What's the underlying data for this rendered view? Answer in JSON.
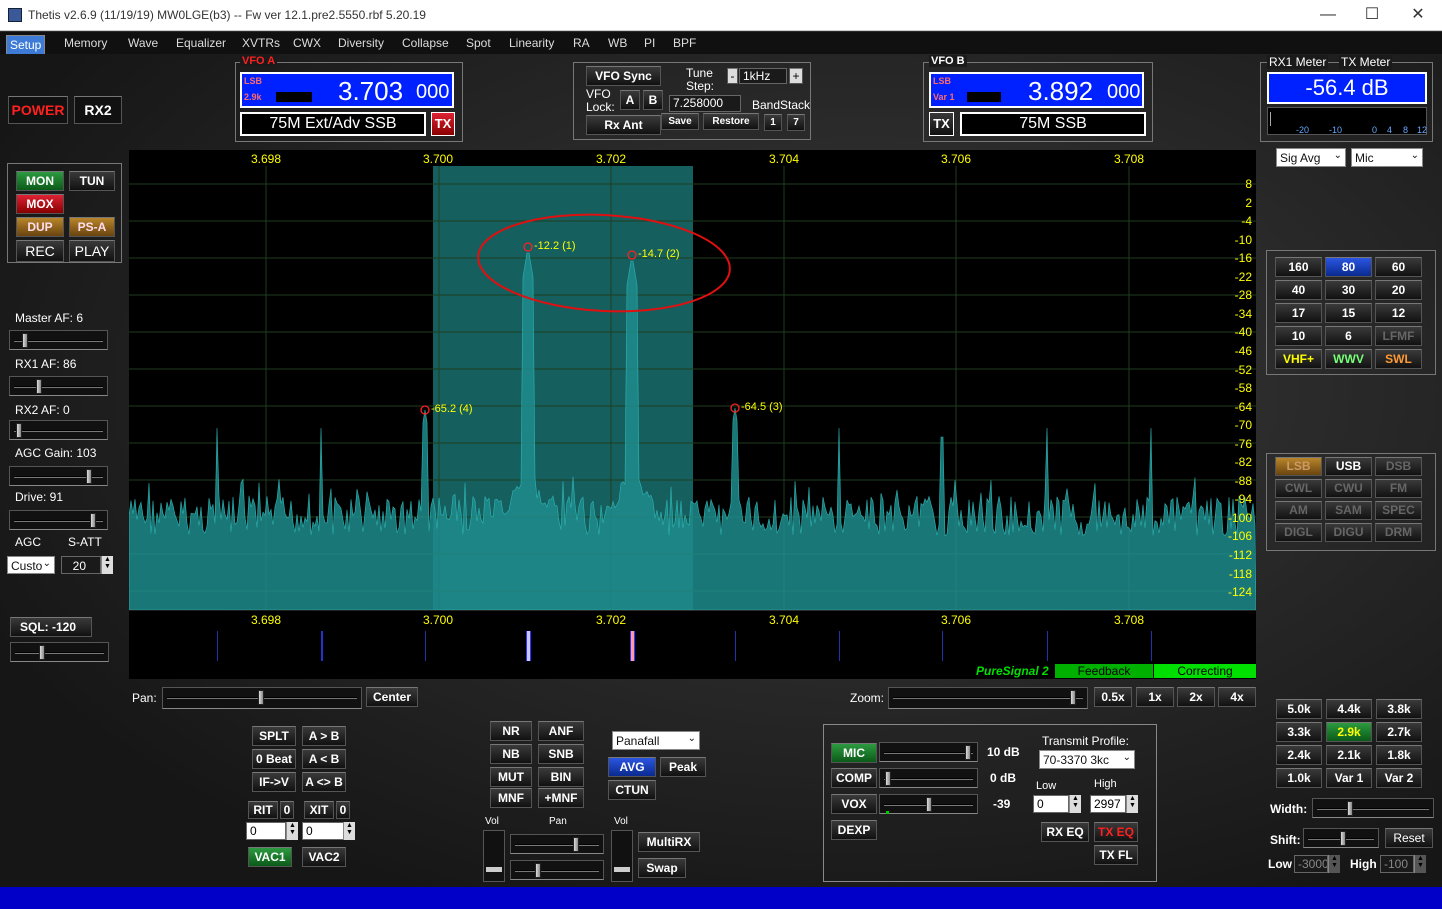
{
  "window": {
    "title": "Thetis v2.6.9 (11/19/19) MW0LGE(b3)   --   Fw ver 12.1.pre2.5550.rbf 5.20.19",
    "minimize": "—",
    "maximize": "☐",
    "close": "✕"
  },
  "menu": [
    "Setup",
    "Memory",
    "Wave",
    "Equalizer",
    "XVTRs",
    "CWX",
    "Diversity",
    "Collapse",
    "Spot",
    "Linearity",
    "RA",
    "WB",
    "PI",
    "BPF"
  ],
  "power": {
    "power": "POWER",
    "rx2": "RX2"
  },
  "mode_buttons": {
    "mon": "MON",
    "tun": "TUN",
    "mox": "MOX",
    "dup": "DUP",
    "psa": "PS-A",
    "rec": "REC",
    "play": "PLAY"
  },
  "left_controls": {
    "master_af": "Master AF:  6",
    "rx1_af": "RX1 AF:  86",
    "rx2_af": "RX2 AF:  0",
    "agc_gain": "AGC Gain:  103",
    "drive": "Drive:  91",
    "agc": "AGC",
    "satt": "S-ATT",
    "agc_mode": "Custo",
    "satt_value": "20",
    "sql": "SQL: -120"
  },
  "vfo_a": {
    "title": "VFO A",
    "mode": "LSB",
    "filter": "2.9k",
    "freq_main": "3.703",
    "freq_sub": "000",
    "band": "75M Ext/Adv SSB",
    "tx": "TX"
  },
  "vfo_sync": {
    "sync": "VFO Sync",
    "tune": "Tune",
    "step": "Step:",
    "minus": "-",
    "step_value": "1kHz",
    "plus": "+",
    "vfo": "VFO",
    "lock": "Lock:",
    "a": "A",
    "b": "B",
    "freq": "7.258000",
    "bandstack": "BandStack",
    "rxant": "Rx Ant",
    "save": "Save",
    "restore": "Restore",
    "bs1": "1",
    "bs2": "7"
  },
  "vfo_b": {
    "title": "VFO B",
    "mode": "LSB",
    "filter": "Var 1",
    "freq_main": "3.892",
    "freq_sub": "000",
    "band": "75M SSB",
    "tx": "TX"
  },
  "meters": {
    "rx1_label": "RX1 Meter",
    "tx_label": "TX Meter",
    "value": "-56.4 dB",
    "scale": [
      "-20",
      "-10",
      "0",
      "4",
      "8",
      "12"
    ],
    "rx_mode": "Sig Avg",
    "tx_mode": "Mic"
  },
  "spectrum": {
    "freq_ticks": [
      "3.698",
      "3.700",
      "3.702",
      "3.704",
      "3.706",
      "3.708"
    ],
    "db_ticks": [
      "8",
      "2",
      "-4",
      "-10",
      "-16",
      "-22",
      "-28",
      "-34",
      "-40",
      "-46",
      "-52",
      "-58",
      "-64",
      "-70",
      "-76",
      "-82",
      "-88",
      "-94",
      "-100",
      "-106",
      "-112",
      "-118",
      "-124"
    ],
    "markers": [
      "-12.2 (1)",
      "-14.7 (2)",
      "-65.2 (4)",
      "-64.5 (3)"
    ],
    "puresignal": "PureSignal 2",
    "feedback": "Feedback",
    "correcting": "Correcting"
  },
  "bands": [
    "160",
    "80",
    "60",
    "40",
    "30",
    "20",
    "17",
    "15",
    "12",
    "10",
    "6",
    "LFMF",
    "VHF+",
    "WWV",
    "SWL"
  ],
  "modes": [
    "LSB",
    "USB",
    "DSB",
    "CWL",
    "CWU",
    "FM",
    "AM",
    "SAM",
    "SPEC",
    "DIGL",
    "DIGU",
    "DRM"
  ],
  "pan_zoom": {
    "pan": "Pan:",
    "center": "Center",
    "zoom": "Zoom:",
    "z05": "0.5x",
    "z1": "1x",
    "z2": "2x",
    "z4": "4x"
  },
  "vfo_ops": {
    "splt": "SPLT",
    "atob": "A > B",
    "beat": "0 Beat",
    "btoa": "A < B",
    "ifv": "IF->V",
    "swap": "A <> B",
    "rit": "RIT",
    "rit_val": "0",
    "xit": "XIT",
    "xit_val": "0",
    "rit_field": "0",
    "xit_field": "0",
    "vac1": "VAC1",
    "vac2": "VAC2"
  },
  "dsp": {
    "nr": "NR",
    "anf": "ANF",
    "nb": "NB",
    "snb": "SNB",
    "mut": "MUT",
    "bin": "BIN",
    "mnf": "MNF",
    "pmnf": "+MNF",
    "display": "Panafall",
    "avg": "AVG",
    "peak": "Peak",
    "ctun": "CTUN"
  },
  "rx_mix": {
    "vol": "Vol",
    "pan": "Pan",
    "vol2": "Vol",
    "multirx": "MultiRX",
    "swap": "Swap"
  },
  "tx_panel": {
    "mic": "MIC",
    "mic_val": "10 dB",
    "comp": "COMP",
    "comp_val": "0 dB",
    "vox": "VOX",
    "vox_val": "-39",
    "dexp": "DEXP",
    "profile_label": "Transmit Profile:",
    "profile": "70-3370 3kc",
    "low": "Low",
    "high": "High",
    "low_val": "0",
    "high_val": "2997",
    "rxeq": "RX EQ",
    "txeq": "TX EQ",
    "txfl": "TX FL"
  },
  "filters": [
    "5.0k",
    "4.4k",
    "3.8k",
    "3.3k",
    "2.9k",
    "2.7k",
    "2.4k",
    "2.1k",
    "1.8k",
    "1.0k",
    "Var 1",
    "Var 2"
  ],
  "filter_ctrl": {
    "width": "Width:",
    "shift": "Shift:",
    "reset": "Reset",
    "low": "Low",
    "low_val": "-3000",
    "high": "High",
    "high_val": "-100"
  },
  "colors": {
    "vfo_blue": "#0021ff",
    "spectrum_fill": "#1e8c8c",
    "filter_band": "#155f5f",
    "marker_red": "#ff2020",
    "text_yellow": "#ffff00",
    "ps_green": "#00e000"
  }
}
